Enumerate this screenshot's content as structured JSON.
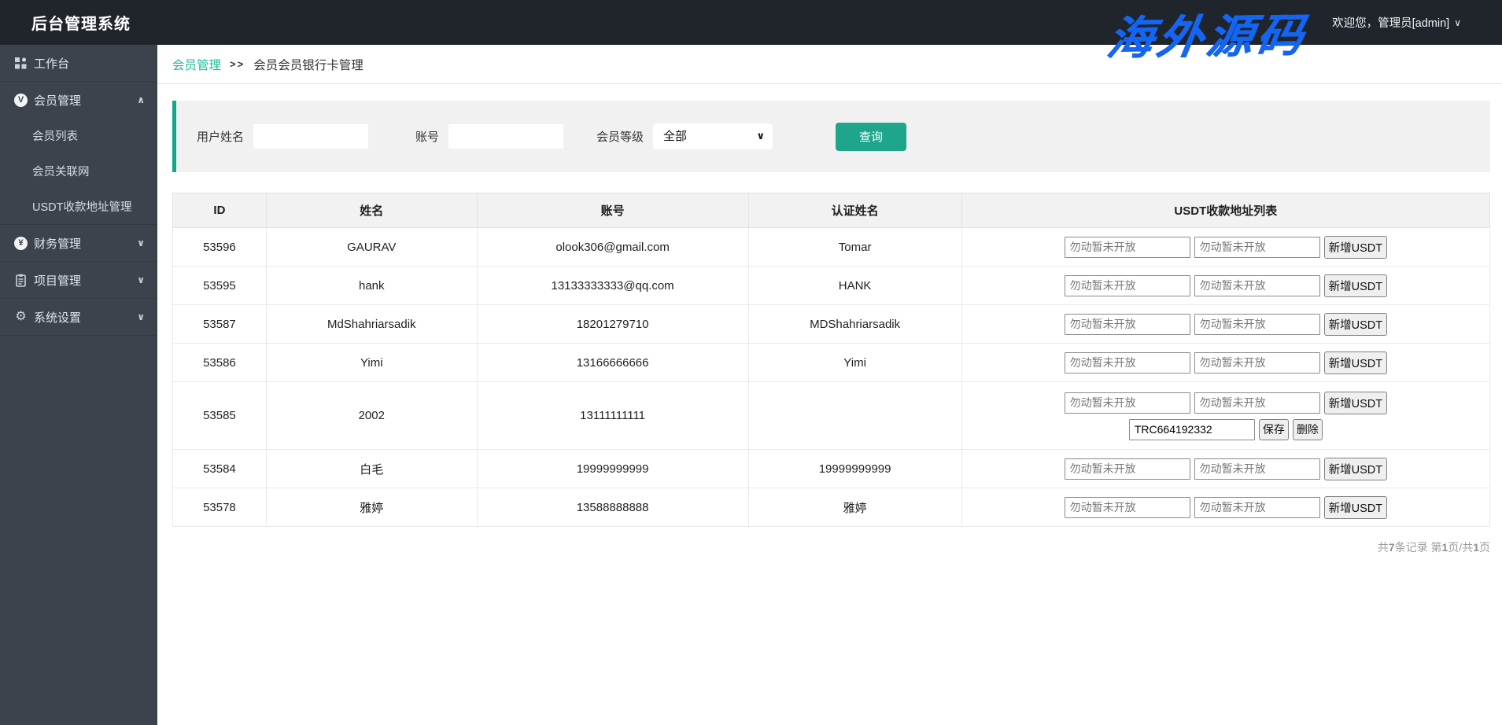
{
  "app": {
    "title": "后台管理系统",
    "watermark": "海外源码"
  },
  "header": {
    "welcome": "欢迎您，管理员[admin]",
    "caret": "∨"
  },
  "icons": {
    "member_letter": "V",
    "finance_symbol": "¥",
    "gear": "⚙",
    "chevron_up": "∧",
    "chevron_down": "∨",
    "select_caret": "∨"
  },
  "sidebar": {
    "workbench": "工作台",
    "member": "会员管理",
    "member_list": "会员列表",
    "member_network": "会员关联网",
    "usdt_address": "USDT收款地址管理",
    "finance": "财务管理",
    "project": "项目管理",
    "settings": "系统设置"
  },
  "breadcrumb": {
    "parent": "会员管理",
    "sep": ">>",
    "current": "会员会员银行卡管理"
  },
  "filter": {
    "name_label": "用户姓名",
    "account_label": "账号",
    "level_label": "会员等级",
    "level_value": "全部",
    "search_label": "查询"
  },
  "table": {
    "headers": [
      "ID",
      "姓名",
      "账号",
      "认证姓名",
      "USDT收款地址列表"
    ],
    "usdt": {
      "placeholder": "勿动暂未开放",
      "add_label": "新增USDT",
      "save_label": "保存",
      "delete_label": "删除"
    },
    "rows": [
      {
        "id": "53596",
        "name": "GAURAV",
        "account": "olook306@gmail.com",
        "verified": "Tomar"
      },
      {
        "id": "53595",
        "name": "hank",
        "account": "13133333333@qq.com",
        "verified": "HANK"
      },
      {
        "id": "53587",
        "name": "MdShahriarsadik",
        "account": "18201279710",
        "verified": "MDShahriarsadik"
      },
      {
        "id": "53586",
        "name": "Yimi",
        "account": "13166666666",
        "verified": "Yimi"
      },
      {
        "id": "53585",
        "name": "2002",
        "account": "13111111111",
        "verified": "",
        "usdt_value": "TRC664192332"
      },
      {
        "id": "53584",
        "name": "白毛",
        "account": "19999999999",
        "verified": "19999999999"
      },
      {
        "id": "53578",
        "name": "雅婷",
        "account": "13588888888",
        "verified": "雅婷"
      }
    ]
  },
  "footer": {
    "t1": "共",
    "count": "7",
    "t2": "条记录 第",
    "page": "1",
    "t3": "页/共",
    "total": "1",
    "t4": "页"
  },
  "colors": {
    "accent": "#1abc9c",
    "button_teal": "#1ea58c",
    "topbar": "#20242b",
    "sidebar": "#3c434d",
    "watermark_blue": "#1465f2"
  }
}
